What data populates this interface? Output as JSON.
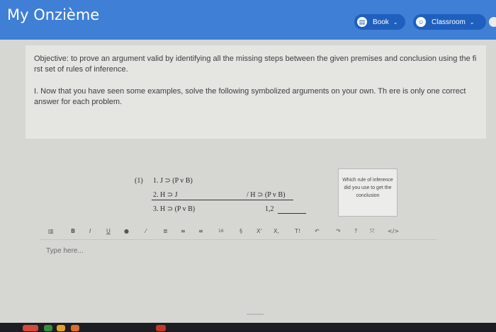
{
  "app": {
    "title": "My Onzième"
  },
  "nav": {
    "book_label": "Book",
    "classroom_label": "Classroom",
    "chevron": "⌄"
  },
  "objective": {
    "text": "Objective: to prove an argument valid by identifying all the missing steps between the given premises and conclusion using the fi rst set of rules of inference."
  },
  "instruction": {
    "text": "I. Now that you have seen some examples, solve the following symbolized arguments on your own. Th ere is only one correct answer for each problem."
  },
  "problem": {
    "number": "(1)",
    "line1": "1. J ⊃ (P v B)",
    "line2": "2. H ⊃ J",
    "line3": "3. H ⊃ (P v B)",
    "conclusion": "/ H ⊃ (P v B)",
    "justification": "1,2"
  },
  "hint_box": {
    "text": "Which rule of inference did you use to get the conclusion"
  },
  "toolbar": {
    "bold": "B",
    "italic": "I",
    "underline": "U",
    "font_size": "16",
    "superscript": "X'",
    "subscript": "X,",
    "clear_format": "T!",
    "undo": "↶",
    "redo": "↷",
    "help": "?",
    "fullscreen": "⤧",
    "code": "</>"
  },
  "editor": {
    "placeholder": "Type here..."
  },
  "colors": {
    "topbar": "#3f7fd6",
    "nav_button": "#1f5fbe"
  }
}
